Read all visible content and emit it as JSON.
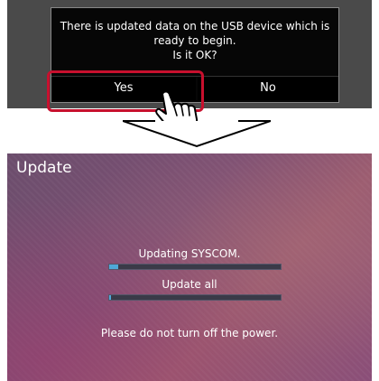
{
  "dialog": {
    "message_lines": [
      "There is updated data on the USB device which is",
      "ready to begin.",
      "Is it OK?"
    ],
    "yes_label": "Yes",
    "no_label": "No"
  },
  "update_screen": {
    "title": "Update",
    "items": [
      {
        "label": "Updating SYSCOM.",
        "progress_percent": 5
      },
      {
        "label": "Update all",
        "progress_percent": 1
      }
    ],
    "warning": "Please do not turn off the power."
  },
  "colors": {
    "highlight": "#c8102e",
    "progress_fill": "#4fa8d8"
  },
  "icons": [
    "tapping-hand-icon",
    "down-arrow-icon"
  ]
}
